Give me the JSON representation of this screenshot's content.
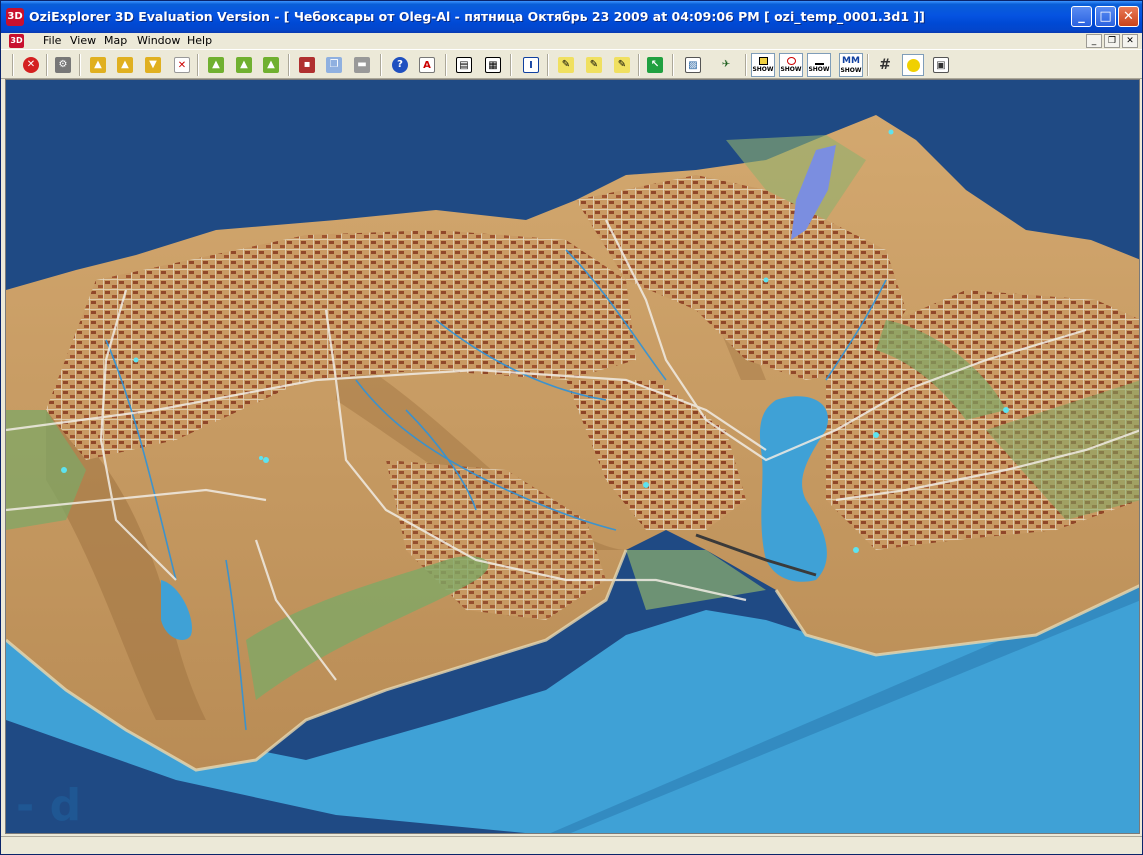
{
  "window": {
    "app_icon": "3D",
    "title": "OziExplorer 3D Evaluation Version - [ Чебоксары от Oleg-Al - пятница Октябрь 23 2009  at  04:09:06 PM  [ ozi_temp_0001.3d1 ]]",
    "caption_buttons": {
      "minimize": "_",
      "maximize": "□",
      "close": "✕"
    }
  },
  "menu": {
    "icon": "3D",
    "items": [
      "File",
      "View",
      "Map",
      "Window",
      "Help"
    ],
    "mdi_buttons": [
      "_",
      "❐",
      "✕"
    ]
  },
  "toolbar": {
    "show_buttons": [
      "SHOW",
      "SHOW",
      "SHOW",
      "SHOW"
    ],
    "mm_label": "MM"
  },
  "map_view": {
    "watermark": "- d",
    "colors": {
      "background": "#1f4a84",
      "water": "#3fa1d6",
      "terrain": "#c9a36a",
      "urban": "#8a5a3c",
      "vegetation": "#7fa765"
    }
  }
}
